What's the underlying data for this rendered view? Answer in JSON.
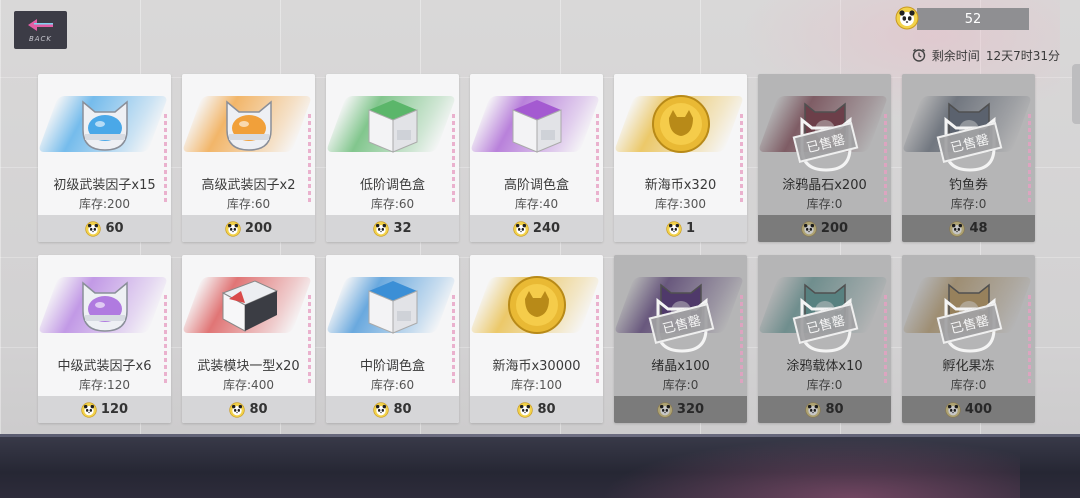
{
  "header": {
    "back_label": "BACK",
    "currency_value": "52",
    "timer_label": "剩余时间",
    "timer_value": "12天7时31分"
  },
  "sold_label": "已售罄",
  "stock_prefix": "库存:",
  "items": [
    {
      "name": "初级武装因子x15",
      "stock": "库存:200",
      "price": "60",
      "icon": "cat-helmet-blue",
      "color": "#4aa8e8",
      "sold": false
    },
    {
      "name": "高级武装因子x2",
      "stock": "库存:60",
      "price": "200",
      "icon": "cat-helmet-orange",
      "color": "#f1a03a",
      "sold": false
    },
    {
      "name": "低阶调色盒",
      "stock": "库存:60",
      "price": "32",
      "icon": "paint-box-green",
      "color": "#5bb66a",
      "sold": false
    },
    {
      "name": "高阶调色盒",
      "stock": "库存:40",
      "price": "240",
      "icon": "paint-box-purple",
      "color": "#a45ad1",
      "sold": false
    },
    {
      "name": "新海币x320",
      "stock": "库存:300",
      "price": "1",
      "icon": "gold-coin",
      "color": "#e8b93a",
      "sold": false
    },
    {
      "name": "涂鸦晶石x200",
      "stock": "库存:0",
      "price": "200",
      "icon": "paint-crystal",
      "color": "#c2405e",
      "sold": true
    },
    {
      "name": "钓鱼券",
      "stock": "库存:0",
      "price": "48",
      "icon": "fishing-ticket",
      "color": "#6a7fa0",
      "sold": true
    },
    {
      "name": "中级武装因子x6",
      "stock": "库存:120",
      "price": "120",
      "icon": "cat-helmet-purple",
      "color": "#b07ae0",
      "sold": false
    },
    {
      "name": "武装模块一型x20",
      "stock": "库存:400",
      "price": "80",
      "icon": "armor-module",
      "color": "#d94a4a",
      "sold": false
    },
    {
      "name": "中阶调色盒",
      "stock": "库存:60",
      "price": "80",
      "icon": "paint-box-blue",
      "color": "#3b8fd6",
      "sold": false
    },
    {
      "name": "新海币x30000",
      "stock": "库存:100",
      "price": "80",
      "icon": "gold-coin",
      "color": "#e8b93a",
      "sold": false
    },
    {
      "name": "绪晶x100",
      "stock": "库存:0",
      "price": "320",
      "icon": "emotion-crystal",
      "color": "#7b3cc9",
      "sold": true
    },
    {
      "name": "涂鸦载体x10",
      "stock": "库存:0",
      "price": "80",
      "icon": "graffiti-carrier",
      "color": "#3fb3b0",
      "sold": true
    },
    {
      "name": "孵化果冻",
      "stock": "库存:0",
      "price": "400",
      "icon": "hatch-jelly",
      "color": "#e0a23a",
      "sold": true
    }
  ]
}
